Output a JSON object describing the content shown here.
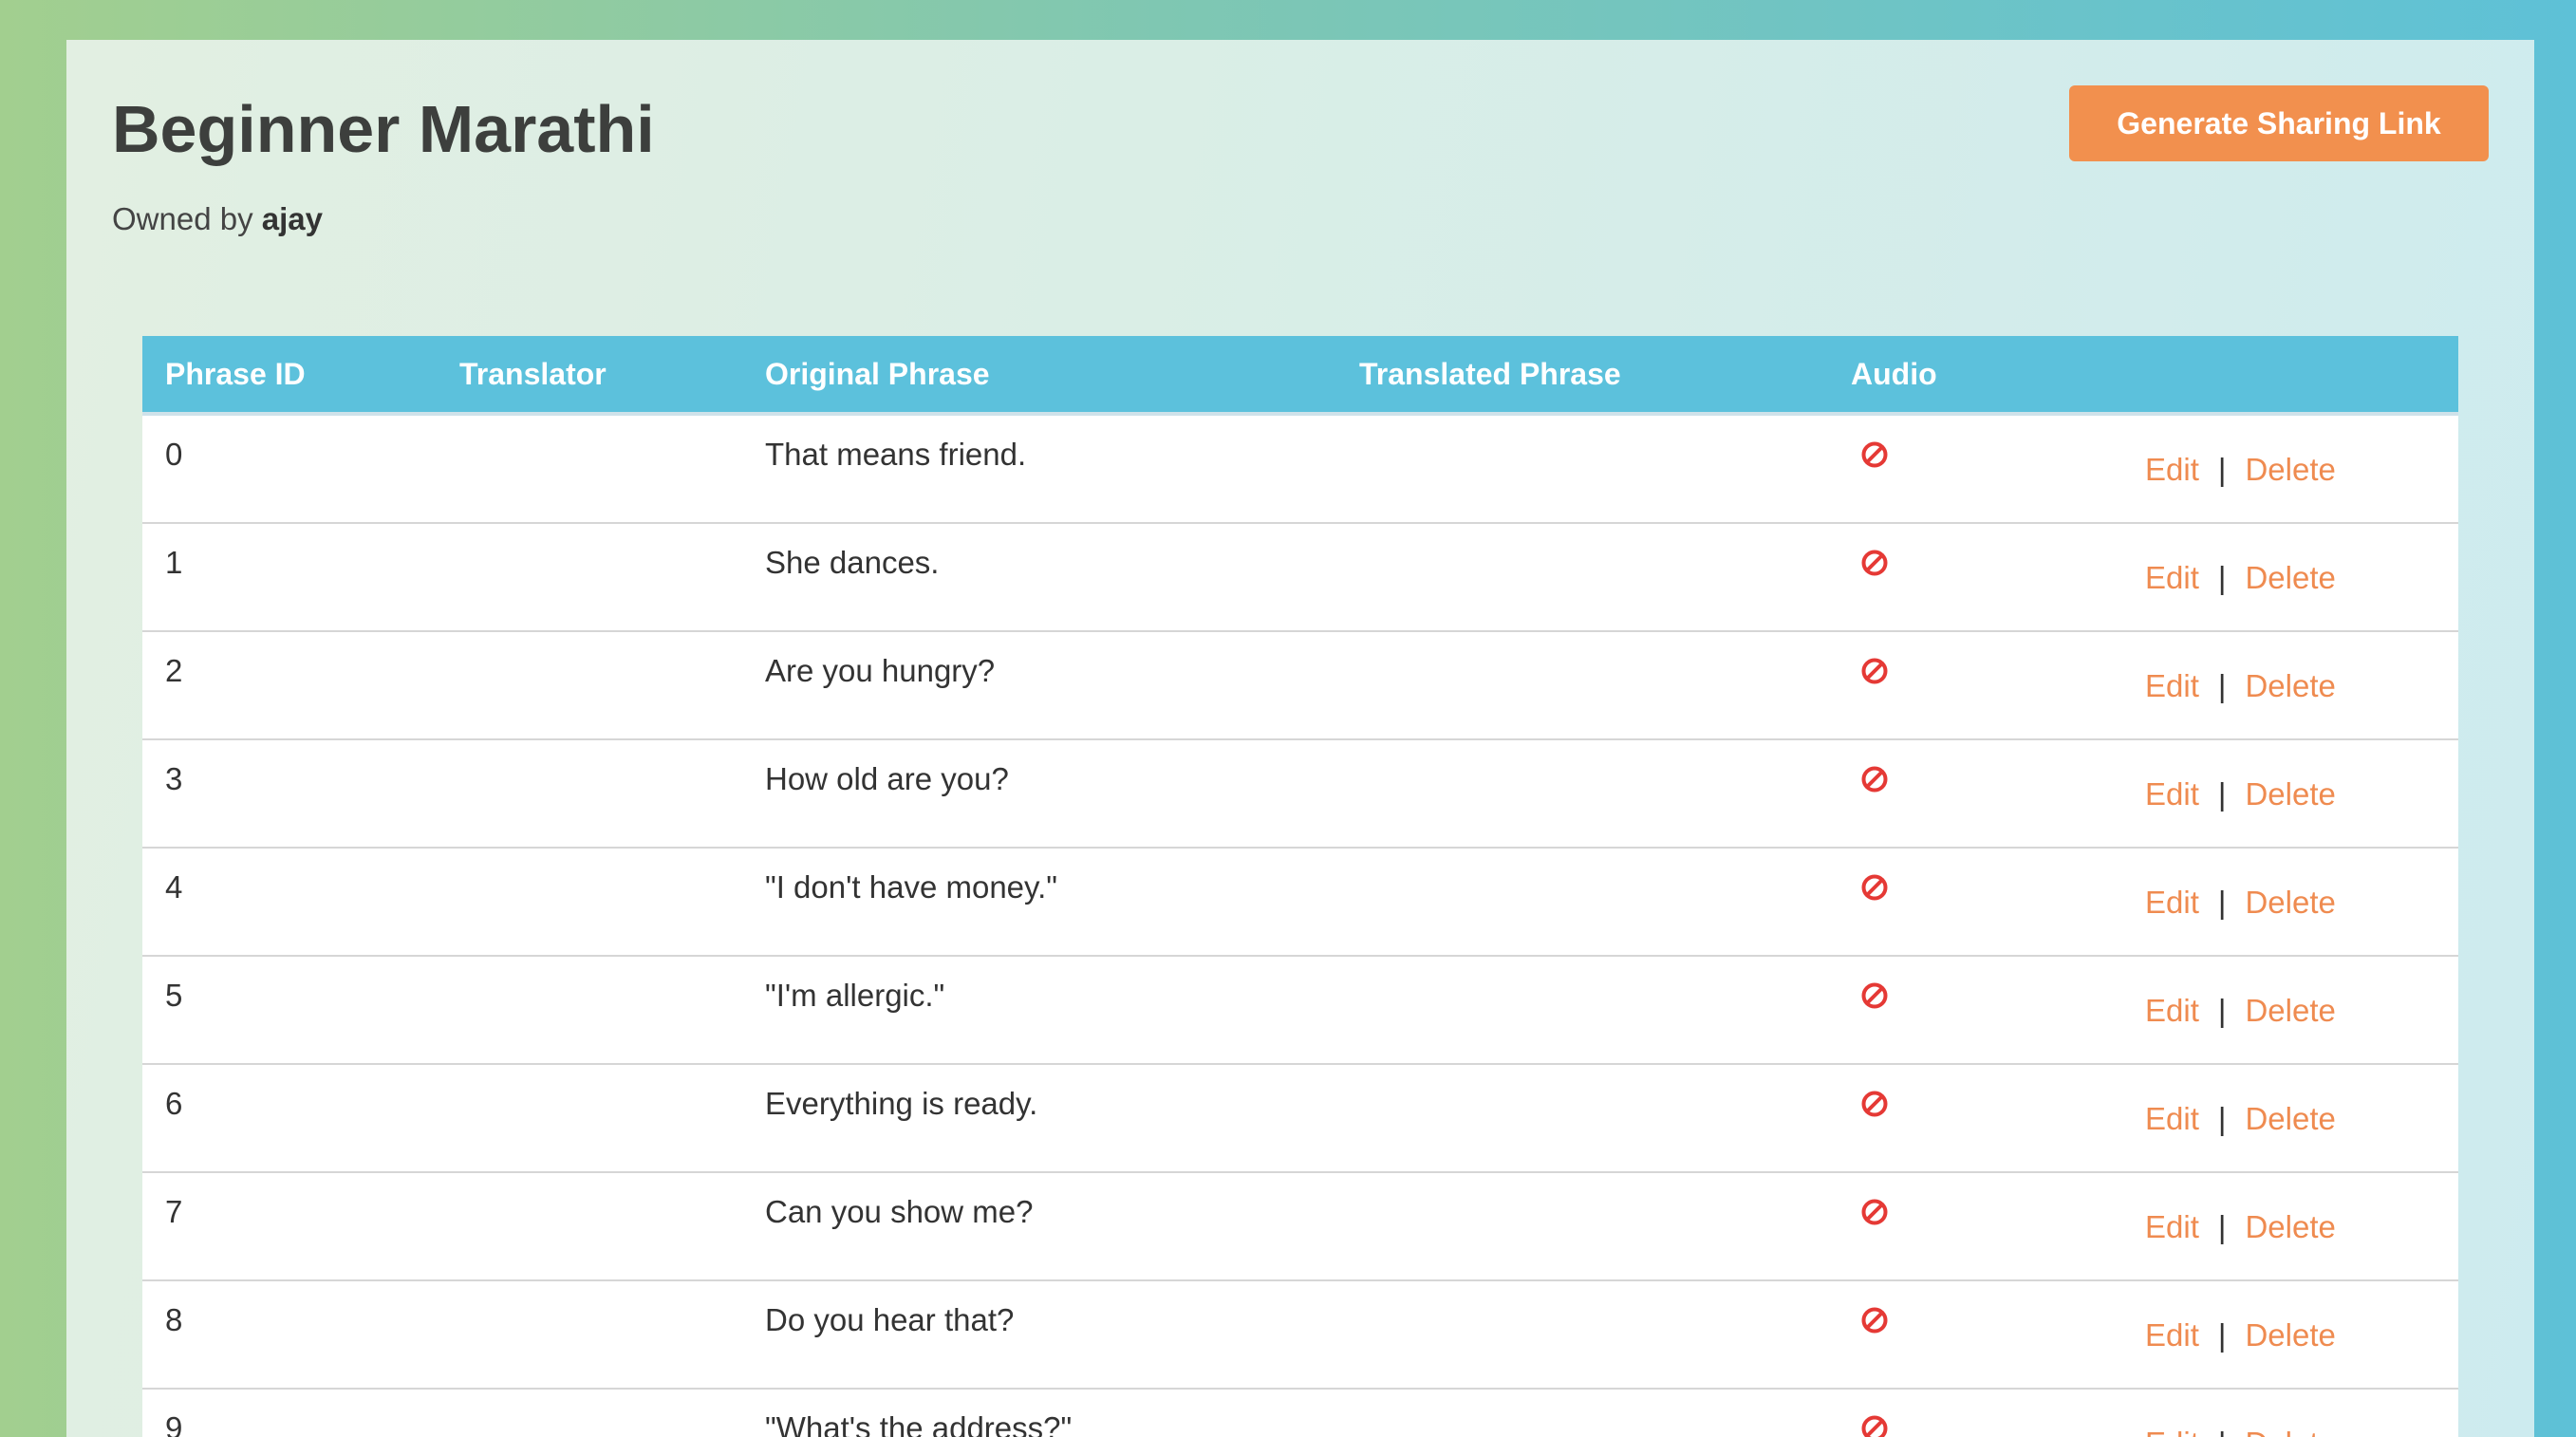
{
  "page": {
    "title": "Beginner Marathi",
    "owned_by_label": "Owned by",
    "owner": "ajay",
    "share_button": "Generate Sharing Link"
  },
  "table": {
    "headers": [
      "Phrase ID",
      "Translator",
      "Original Phrase",
      "Translated Phrase",
      "Audio"
    ],
    "edit_label": "Edit",
    "delete_label": "Delete",
    "separator": "|",
    "rows": [
      {
        "id": "0",
        "translator": "",
        "original": "That means friend.",
        "translated": ""
      },
      {
        "id": "1",
        "translator": "",
        "original": "She dances.",
        "translated": ""
      },
      {
        "id": "2",
        "translator": "",
        "original": "Are you hungry?",
        "translated": ""
      },
      {
        "id": "3",
        "translator": "",
        "original": "How old are you?",
        "translated": ""
      },
      {
        "id": "4",
        "translator": "",
        "original": "\"I don't have money.\"",
        "translated": ""
      },
      {
        "id": "5",
        "translator": "",
        "original": "\"I'm allergic.\"",
        "translated": ""
      },
      {
        "id": "6",
        "translator": "",
        "original": "Everything is ready.",
        "translated": ""
      },
      {
        "id": "7",
        "translator": "",
        "original": "Can you show me?",
        "translated": ""
      },
      {
        "id": "8",
        "translator": "",
        "original": "Do you hear that?",
        "translated": ""
      },
      {
        "id": "9",
        "translator": "",
        "original": "\"What's the address?\"",
        "translated": ""
      }
    ]
  },
  "icons": {
    "audio": "no-audio-icon"
  },
  "colors": {
    "accent": "#f2904e",
    "header": "#5cc1dc",
    "link": "#ef8b50",
    "no_audio": "#e53935"
  }
}
